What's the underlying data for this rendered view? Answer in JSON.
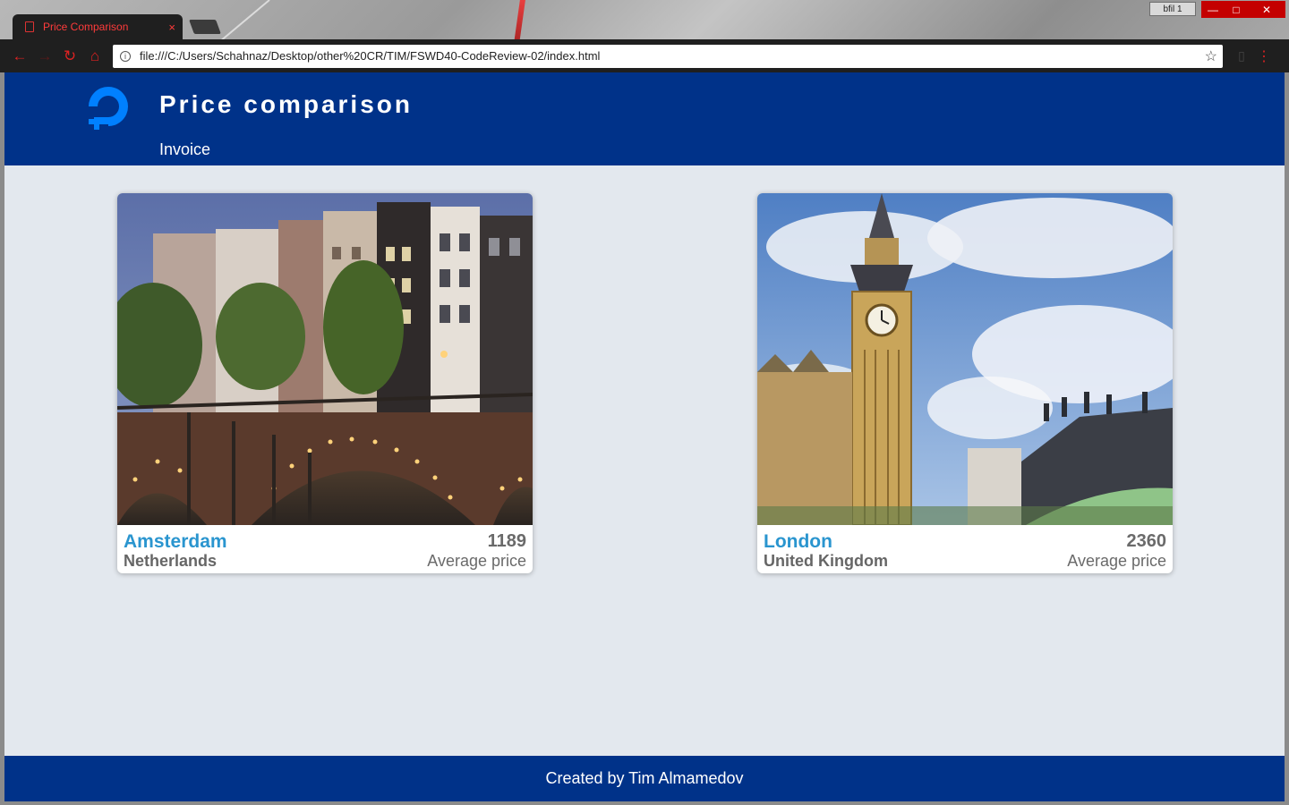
{
  "browser": {
    "tab_title": "Price Comparison",
    "tab_close": "×",
    "profile_label": "bfil 1",
    "url": "file:///C:/Users/Schahnaz/Desktop/other%20CR/TIM/FSWD40-CodeReview-02/index.html",
    "icons": [
      "page-icon",
      "back-icon",
      "forward-icon",
      "reload-icon",
      "home-icon",
      "info-icon",
      "star-icon",
      "bookmark-icon",
      "menu-icon"
    ],
    "accent_color": "#ff3b3b"
  },
  "header": {
    "title": "Price comparison",
    "nav": [
      "Invoice"
    ],
    "background": "#003289"
  },
  "cards": [
    {
      "city": "Amsterdam",
      "country": "Netherlands",
      "price": "1189",
      "price_label": "Average price",
      "image": "amsterdam-canal-bridge-photo"
    },
    {
      "city": "London",
      "country": "United Kingdom",
      "price": "2360",
      "price_label": "Average price",
      "image": "london-big-ben-photo"
    }
  ],
  "footer": {
    "text": "Created by Tim Almamedov"
  },
  "colors": {
    "page_background": "#e3e8ee",
    "city_link": "#2a95cf",
    "muted_text": "#6a6a6a"
  }
}
